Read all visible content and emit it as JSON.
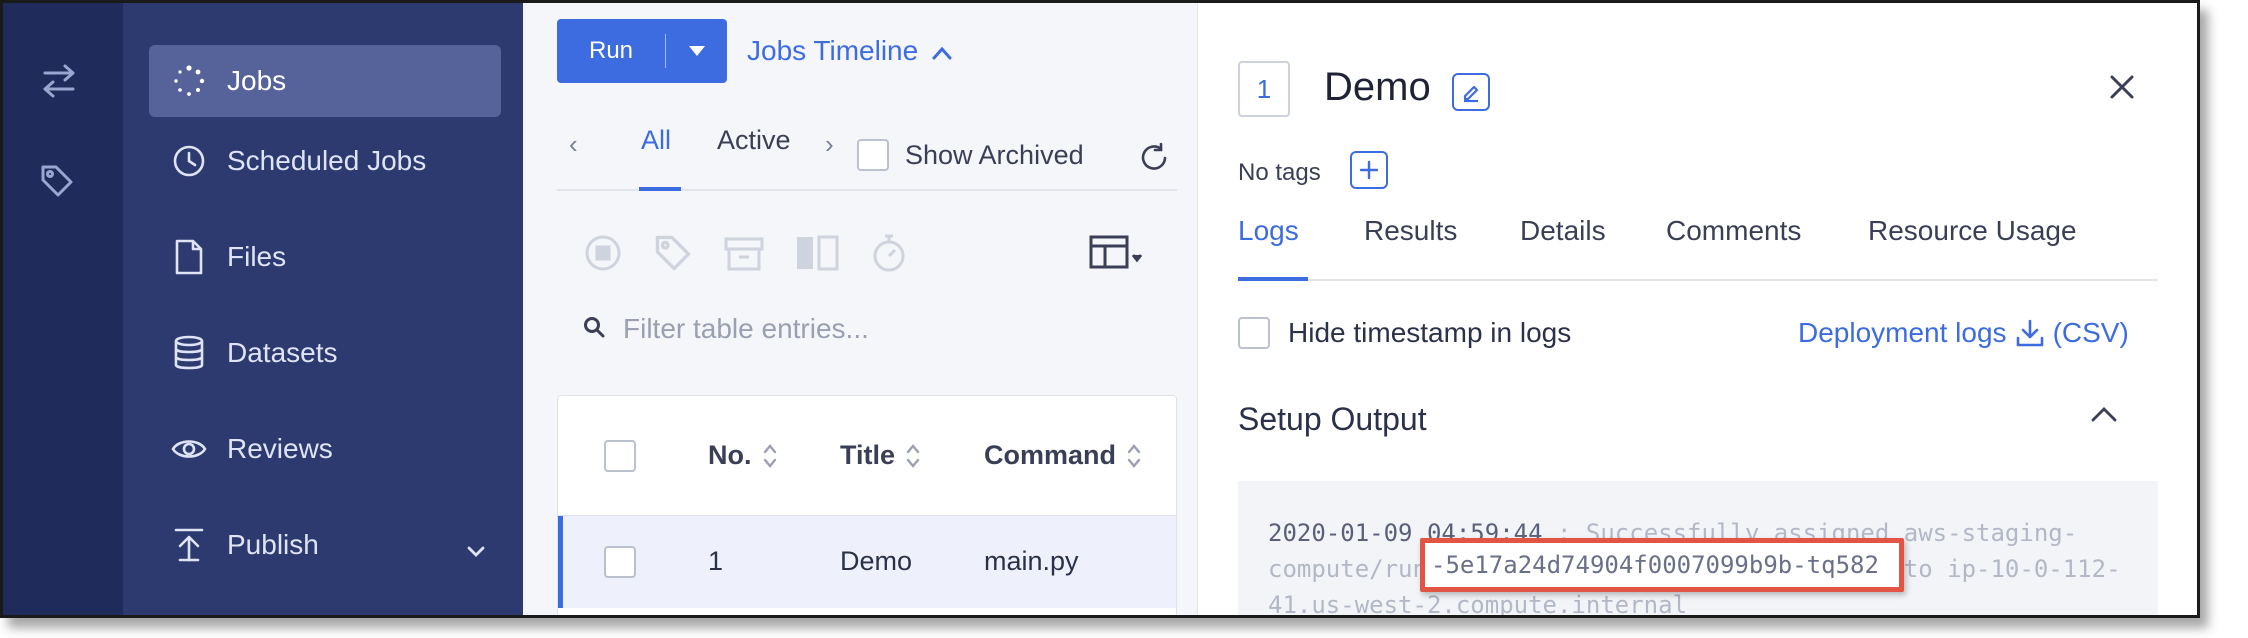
{
  "rail": {
    "icons": [
      "swap-arrows-icon",
      "tag-icon"
    ]
  },
  "sidenav": {
    "items": [
      {
        "label": "Jobs",
        "icon": "spinner-icon",
        "active": true
      },
      {
        "label": "Scheduled Jobs",
        "icon": "clock-icon"
      },
      {
        "label": "Files",
        "icon": "file-icon"
      },
      {
        "label": "Datasets",
        "icon": "database-icon"
      },
      {
        "label": "Reviews",
        "icon": "eye-icon"
      },
      {
        "label": "Publish",
        "icon": "upload-icon",
        "has_children": true
      }
    ]
  },
  "jobs_panel": {
    "run_label": "Run",
    "timeline_label": "Jobs Timeline",
    "tabs": [
      "All",
      "Active"
    ],
    "active_tab": "All",
    "show_archived_label": "Show Archived",
    "filter_placeholder": "Filter table entries...",
    "table": {
      "columns": [
        "No.",
        "Title",
        "Command"
      ],
      "rows": [
        {
          "no": "1",
          "title": "Demo",
          "command": "main.py",
          "selected": true
        }
      ]
    }
  },
  "detail": {
    "job_number": "1",
    "title": "Demo",
    "no_tags_label": "No tags",
    "tabs": [
      "Logs",
      "Results",
      "Details",
      "Comments",
      "Resource Usage"
    ],
    "active_tab": "Logs",
    "hide_timestamp_label": "Hide timestamp in logs",
    "deployment_logs_label": "Deployment logs",
    "csv_label": "(CSV)",
    "setup_output_label": "Setup Output",
    "log": {
      "timestamp": "2020-01-09 04:59:44",
      "line1": " : Successfully assigned aws-staging-",
      "line2_prefix": "compute/run",
      "line2_suffix": "to ip-10-0-112-",
      "line3": "41.us-west-2.compute.internal",
      "highlighted": "-5e17a24d74904f0007099b9b-tq582"
    }
  },
  "colors": {
    "accent": "#3d6ce0",
    "rail": "#1f2b5a",
    "sidenav": "#2d3a70",
    "highlight_border": "#e25545"
  }
}
